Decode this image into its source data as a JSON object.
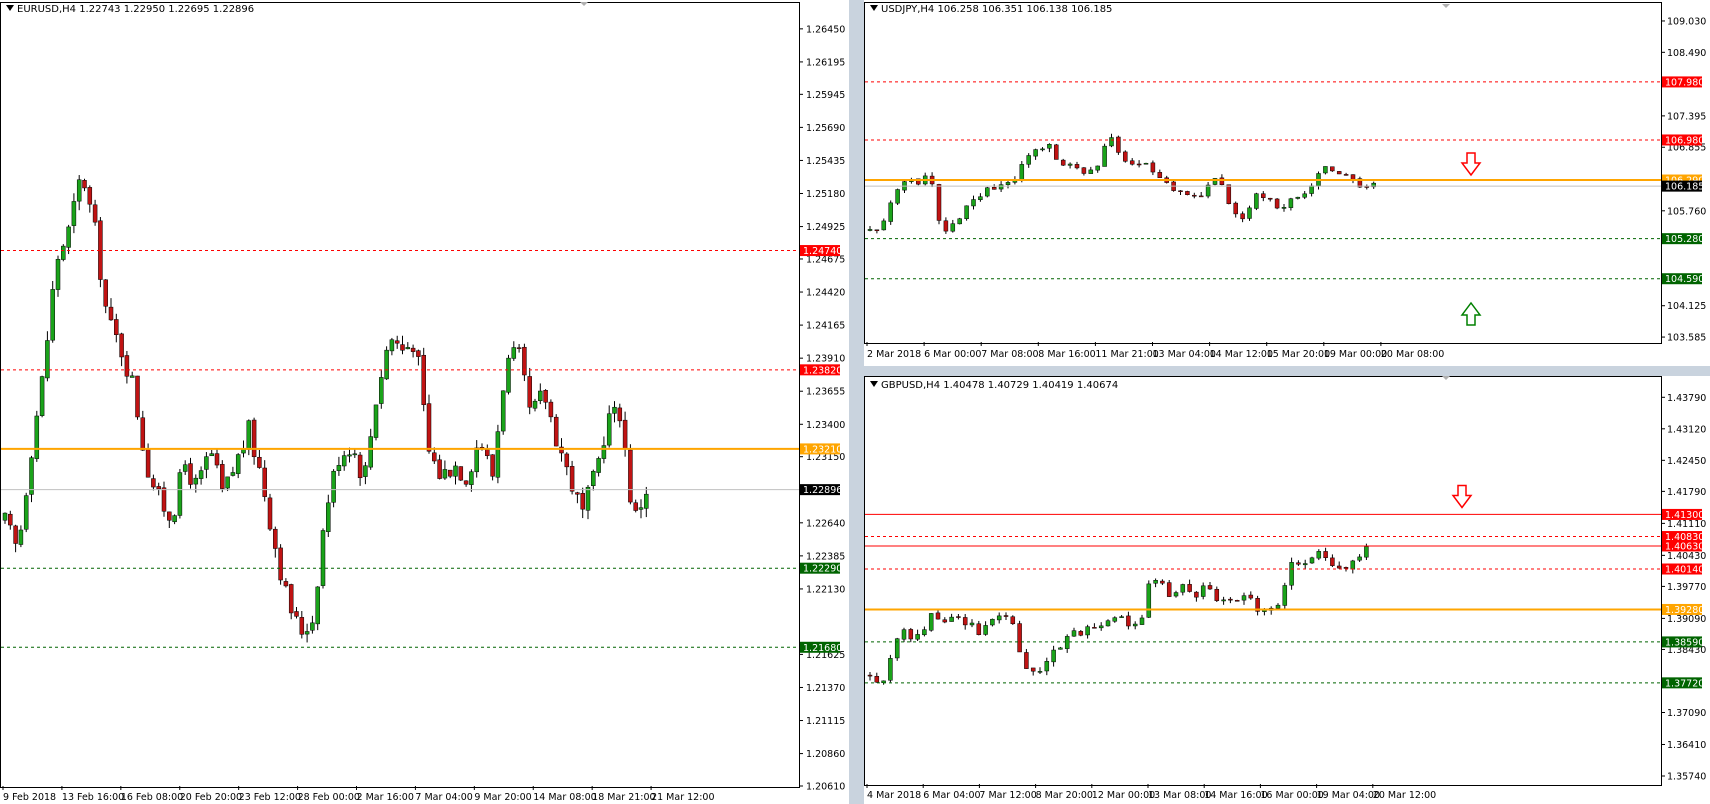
{
  "colors": {
    "bull": "#1aa31a",
    "bear": "#c01313",
    "wick": "#000000",
    "resistance": "#ff0000",
    "support": "#006400",
    "pivot": "#ffa500",
    "last": "#000000",
    "bid_line": "#c0c0c0"
  },
  "charts": [
    {
      "id": "eurusd",
      "title": "EURUSD,H4  1.22743 1.22950 1.22695 1.22896",
      "y_ticks": [
        "1.26450",
        "1.26195",
        "1.25945",
        "1.25690",
        "1.25435",
        "1.25180",
        "1.24925",
        "1.24675",
        "1.24420",
        "1.24165",
        "1.23910",
        "1.23655",
        "1.23400",
        "1.23150",
        "1.22640",
        "1.22385",
        "1.22130",
        "1.21625",
        "1.21370",
        "1.21115",
        "1.20860",
        "1.20610"
      ],
      "x_ticks": [
        "9 Feb 2018",
        "13 Feb 16:00",
        "16 Feb 08:00",
        "20 Feb 20:00",
        "23 Feb 12:00",
        "28 Feb 00:00",
        "2 Mar 16:00",
        "7 Mar 04:00",
        "9 Mar 20:00",
        "14 Mar 08:00",
        "18 Mar 21:00",
        "21 Mar 12:00"
      ],
      "levels": [
        {
          "price": "1.24740",
          "kind": "resistance"
        },
        {
          "price": "1.23820",
          "kind": "resistance"
        },
        {
          "price": "1.23210",
          "kind": "pivot"
        },
        {
          "price": "1.22290",
          "kind": "support"
        },
        {
          "price": "1.21680",
          "kind": "support"
        }
      ],
      "last_price": "1.22896",
      "chart_data": {
        "type": "candlestick",
        "symbol": "EURUSD",
        "timeframe": "H4",
        "ylim": [
          1.2061,
          1.2658
        ],
        "path": [
          1.2265,
          1.2242,
          1.2318,
          1.238,
          1.2466,
          1.249,
          1.2535,
          1.249,
          1.242,
          1.24,
          1.237,
          1.231,
          1.2282,
          1.2268,
          1.231,
          1.229,
          1.232,
          1.2285,
          1.231,
          1.2335,
          1.23,
          1.225,
          1.2205,
          1.218,
          1.219,
          1.2275,
          1.2315,
          1.2325,
          1.2298,
          1.2365,
          1.2408,
          1.2398,
          1.2405,
          1.232,
          1.23,
          1.231,
          1.23,
          1.233,
          1.23,
          1.2385,
          1.2395,
          1.2345,
          1.2365,
          1.233,
          1.23,
          1.227,
          1.23,
          1.2345,
          1.235,
          1.2265,
          1.229
        ]
      }
    },
    {
      "id": "usdjpy",
      "title": "USDJPY,H4  106.258 106.351 106.138 106.185",
      "y_ticks": [
        "109.030",
        "108.490",
        "107.395",
        "106.855",
        "105.760",
        "104.125",
        "103.585"
      ],
      "x_ticks": [
        "2 Mar 2018",
        "6 Mar 00:00",
        "7 Mar 08:00",
        "8 Mar 16:00",
        "11 Mar 21:00",
        "13 Mar 04:00",
        "14 Mar 12:00",
        "15 Mar 20:00",
        "19 Mar 00:00",
        "20 Mar 08:00"
      ],
      "levels": [
        {
          "price": "107.980",
          "kind": "resistance"
        },
        {
          "price": "106.980",
          "kind": "resistance"
        },
        {
          "price": "106.290",
          "kind": "pivot"
        },
        {
          "price": "105.280",
          "kind": "support"
        },
        {
          "price": "104.590",
          "kind": "support"
        }
      ],
      "last_price": "106.185",
      "arrows": [
        {
          "dir": "down",
          "price": "106.55"
        },
        {
          "dir": "up",
          "price": "104.0"
        }
      ],
      "chart_data": {
        "type": "candlestick",
        "symbol": "USDJPY",
        "timeframe": "H4",
        "ylim": [
          103.5,
          109.15
        ],
        "path": [
          105.42,
          105.5,
          106.05,
          106.3,
          106.25,
          106.35,
          105.4,
          105.55,
          105.85,
          106.0,
          106.1,
          106.15,
          106.3,
          106.75,
          106.9,
          106.85,
          106.6,
          106.5,
          106.45,
          106.55,
          107.1,
          106.7,
          106.55,
          106.55,
          106.4,
          106.15,
          106.0,
          105.95,
          106.1,
          106.3,
          105.85,
          105.6,
          106.0,
          105.95,
          105.85,
          105.9,
          105.95,
          106.3,
          106.5,
          106.45,
          106.45,
          106.2,
          106.18
        ]
      }
    },
    {
      "id": "gbpusd",
      "title": "GBPUSD,H4  1.40478 1.40729 1.40419 1.40674",
      "y_ticks": [
        "1.43790",
        "1.43120",
        "1.42450",
        "1.41790",
        "1.41110",
        "1.40430",
        "1.39770",
        "1.39090",
        "1.38430",
        "1.37090",
        "1.36410",
        "1.35740"
      ],
      "x_ticks": [
        "4 Mar 2018",
        "6 Mar 04:00",
        "7 Mar 12:00",
        "8 Mar 20:00",
        "12 Mar 00:00",
        "13 Mar 08:00",
        "14 Mar 16:00",
        "16 Mar 00:00",
        "19 Mar 04:00",
        "20 Mar 12:00"
      ],
      "levels": [
        {
          "price": "1.41300",
          "kind": "resistance-solid"
        },
        {
          "price": "1.40830",
          "kind": "resistance"
        },
        {
          "price": "1.40630",
          "kind": "resistance-solid"
        },
        {
          "price": "1.40140",
          "kind": "resistance"
        },
        {
          "price": "1.39280",
          "kind": "pivot"
        },
        {
          "price": "1.38590",
          "kind": "support"
        },
        {
          "price": "1.37720",
          "kind": "support"
        }
      ],
      "last_price": "",
      "arrows": [
        {
          "dir": "down",
          "price": "1.4166"
        }
      ],
      "chart_data": {
        "type": "candlestick",
        "symbol": "GBPUSD",
        "timeframe": "H4",
        "ylim": [
          1.3557,
          1.4403
        ],
        "path": [
          1.379,
          1.376,
          1.383,
          1.388,
          1.385,
          1.389,
          1.392,
          1.391,
          1.392,
          1.39,
          1.388,
          1.3915,
          1.392,
          1.391,
          1.383,
          1.3795,
          1.381,
          1.383,
          1.387,
          1.3875,
          1.389,
          1.388,
          1.39,
          1.3915,
          1.39,
          1.389,
          1.399,
          1.3975,
          1.395,
          1.3975,
          1.396,
          1.398,
          1.395,
          1.3935,
          1.3945,
          1.396,
          1.393,
          1.3935,
          1.393,
          1.404,
          1.403,
          1.4045,
          1.404,
          1.4015,
          1.4005,
          1.403,
          1.4067
        ]
      }
    }
  ]
}
